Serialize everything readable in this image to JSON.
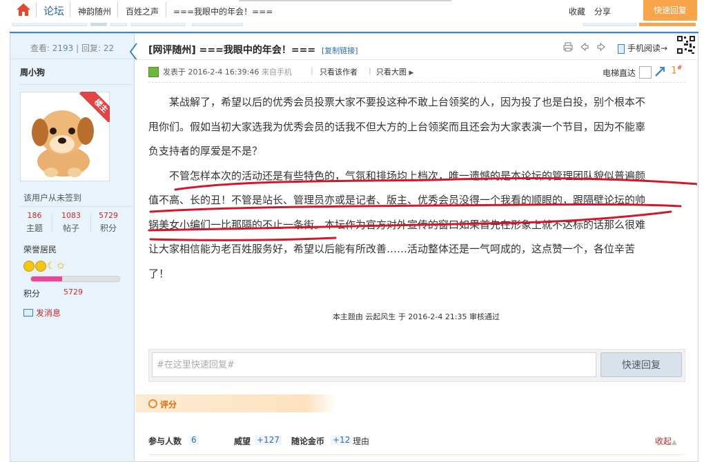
{
  "topbar": {
    "forum": "论坛",
    "crumb1": "神韵随州",
    "crumb2": "百姓之声",
    "crumb3": "===我眼中的年会！===",
    "favorite": "收藏",
    "share": "分享",
    "quick_reply": "快速回复"
  },
  "sidebar": {
    "views_label": "查看:",
    "views": "2193",
    "sep": "|",
    "replies_label": "回复:",
    "replies": "22",
    "author": "周小狗",
    "op_badge": "楼主",
    "signin": "该用户从未签到",
    "stats": [
      {
        "num": "186",
        "label": "主题"
      },
      {
        "num": "1083",
        "label": "帖子"
      },
      {
        "num": "5729",
        "label": "积分"
      }
    ],
    "rank": "荣誉居民",
    "level_progress": 0.35,
    "points_label": "积分",
    "points": "5729",
    "message": "发消息"
  },
  "thread": {
    "title_prefix": "[网评随州]",
    "title": "===我眼中的年会！===",
    "copy_link": "[复制链接]",
    "mobile_read": "手机阅读→",
    "posted_label": "发表于",
    "posted_time": "2016-2-4 16:39:46",
    "source": "来自手机",
    "only_author": "只看该作者",
    "big_image": "只看大图",
    "elevator": "电梯直达",
    "floor": "1",
    "floor_sup": "#"
  },
  "content": {
    "p1_lines": [
      "某战解了，希望以后的优秀会员投票大家不要投这种不敢上台领奖的人，因为投了也是白投，别个根本不",
      "甩你们。假如当初大家选我为优秀会员的话我不但大方的上台领奖而且还会为大家表演一个节目，因为不能辜",
      "负支持者的厚爱是不是？"
    ],
    "p2_lines": [
      "不管怎样本次的活动还是有些特色的，气氛和排场均上档次，唯一遗憾的是本论坛的管理团队貌似普遍颜",
      "值不高、长的丑！不管是站长、管理员亦或是记者、版主、优秀会员没得一个我看的顺眼的，跟隔壁论坛的帅",
      "锅美女小编们一比那隔的不止一条街。本坛作为官方对外宣传的窗口如果首先在形象上就不达标的话那么很难",
      "让大家相信能为老百姓服务好，希望以后能有所改善……活动整体还是一气呵成的，这点赞一个，各位辛苦",
      "了！"
    ]
  },
  "review": "本主题由 云起风生 于 2016-2-4 21:35 审核通过",
  "reply": {
    "placeholder": "#在这里快速回复#",
    "button": "快速回复"
  },
  "rating": {
    "tab": "评分",
    "participants_label": "参与人数",
    "participants": "6",
    "prestige_label": "威望",
    "prestige": "+127",
    "coins_label": "随论金币",
    "coins": "+12",
    "reason_label": "理由",
    "collapse": "收起",
    "collapse_icon": "▲"
  },
  "colors": {
    "accent_blue": "#3f86c6",
    "quick_orange": "#f7a44b",
    "red_marker": "#d8142a"
  }
}
